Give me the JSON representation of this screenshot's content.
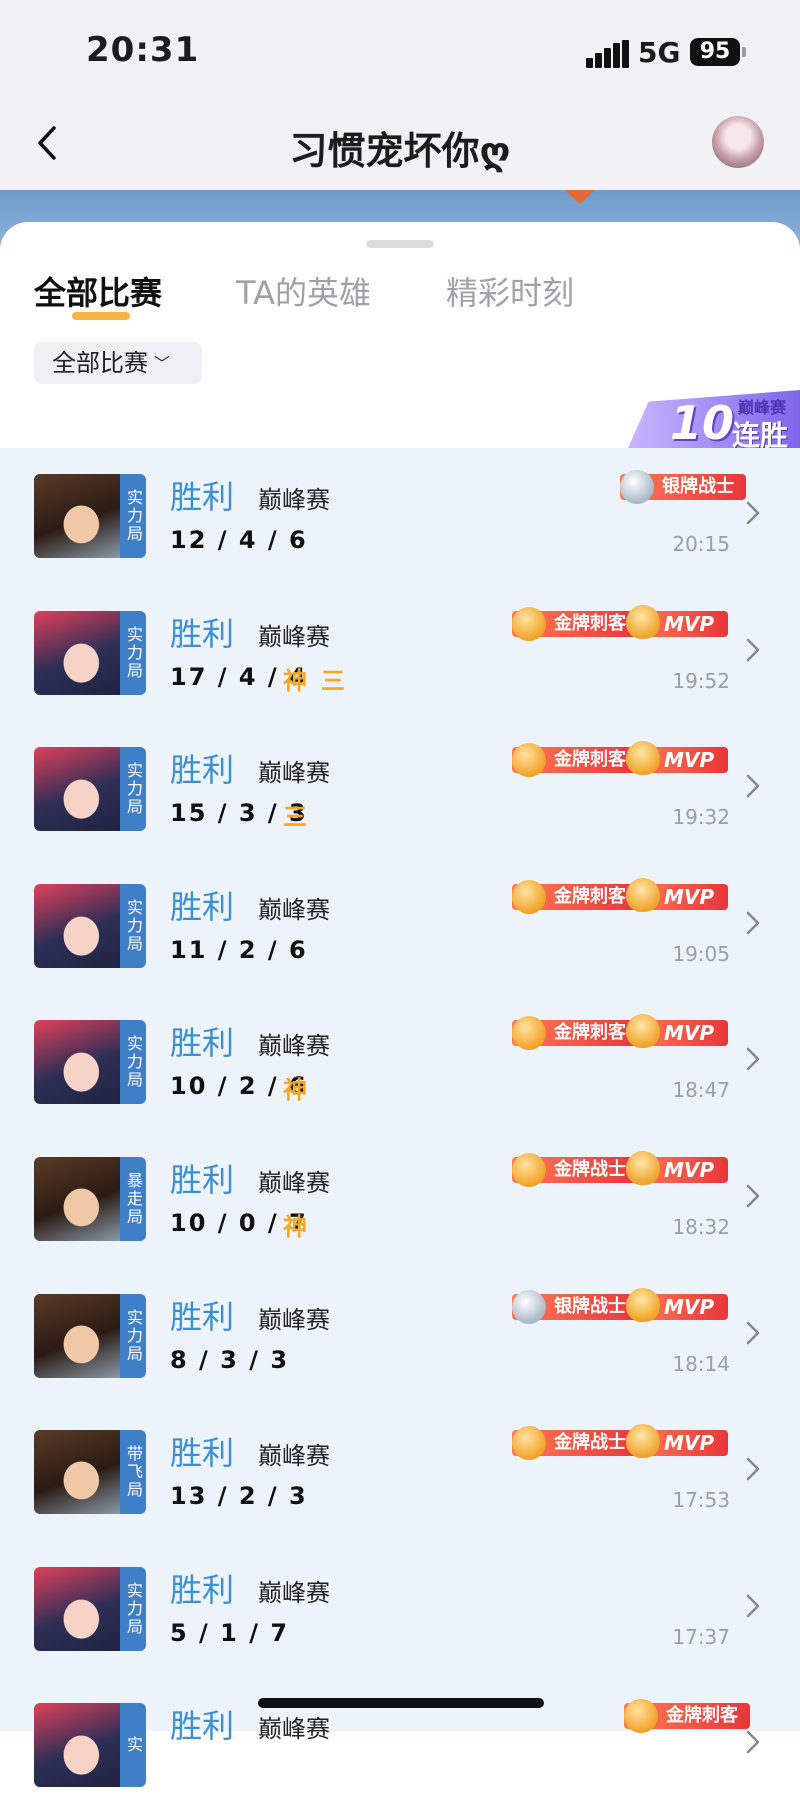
{
  "status": {
    "time": "20:31",
    "network": "5G",
    "battery": "95"
  },
  "header": {
    "title": "习惯宠坏你ღ"
  },
  "tabs": [
    {
      "label": "全部比赛"
    },
    {
      "label": "TA的英雄"
    },
    {
      "label": "精彩时刻"
    }
  ],
  "filter": {
    "label": "全部比赛"
  },
  "streak": {
    "number": "10",
    "mode": "巅峰赛",
    "text": "连胜"
  },
  "matches": [
    {
      "result": "胜利",
      "mode": "巅峰赛",
      "kda": "12 / 4 / 6",
      "tags": [],
      "hero_mode": "实力局",
      "badge": "银牌战士",
      "badge_tier": "silver",
      "mvp": "",
      "time": "20:15"
    },
    {
      "result": "胜利",
      "mode": "巅峰赛",
      "kda": "17 / 4 / 4",
      "tags": [
        "神",
        "三"
      ],
      "hero_mode": "实力局",
      "badge": "金牌刺客",
      "badge_tier": "gold",
      "mvp": "MVP",
      "time": "19:52"
    },
    {
      "result": "胜利",
      "mode": "巅峰赛",
      "kda": "15 / 3 / 3",
      "tags": [
        "三"
      ],
      "hero_mode": "实力局",
      "badge": "金牌刺客",
      "badge_tier": "gold",
      "mvp": "MVP",
      "time": "19:32"
    },
    {
      "result": "胜利",
      "mode": "巅峰赛",
      "kda": "11 / 2 / 6",
      "tags": [],
      "hero_mode": "实力局",
      "badge": "金牌刺客",
      "badge_tier": "gold",
      "mvp": "MVP",
      "time": "19:05"
    },
    {
      "result": "胜利",
      "mode": "巅峰赛",
      "kda": "10 / 2 / 6",
      "tags": [
        "神"
      ],
      "hero_mode": "实力局",
      "badge": "金牌刺客",
      "badge_tier": "gold",
      "mvp": "MVP",
      "time": "18:47"
    },
    {
      "result": "胜利",
      "mode": "巅峰赛",
      "kda": "10 / 0 / 7",
      "tags": [
        "神"
      ],
      "hero_mode": "暴走局",
      "badge": "金牌战士",
      "badge_tier": "gold",
      "mvp": "MVP",
      "time": "18:32"
    },
    {
      "result": "胜利",
      "mode": "巅峰赛",
      "kda": "8 / 3 / 3",
      "tags": [],
      "hero_mode": "实力局",
      "badge": "银牌战士",
      "badge_tier": "silver",
      "mvp": "MVP",
      "time": "18:14"
    },
    {
      "result": "胜利",
      "mode": "巅峰赛",
      "kda": "13 / 2 / 3",
      "tags": [],
      "hero_mode": "带飞局",
      "badge": "金牌战士",
      "badge_tier": "gold",
      "mvp": "MVP",
      "time": "17:53"
    },
    {
      "result": "胜利",
      "mode": "巅峰赛",
      "kda": "5 / 1 / 7",
      "tags": [],
      "hero_mode": "实力局",
      "badge": "",
      "badge_tier": "",
      "mvp": "",
      "time": "17:37"
    },
    {
      "result": "胜利",
      "mode": "巅峰赛",
      "kda": "",
      "tags": [],
      "hero_mode": "实",
      "badge": "金牌刺客",
      "badge_tier": "gold",
      "mvp": "",
      "time": ""
    }
  ]
}
